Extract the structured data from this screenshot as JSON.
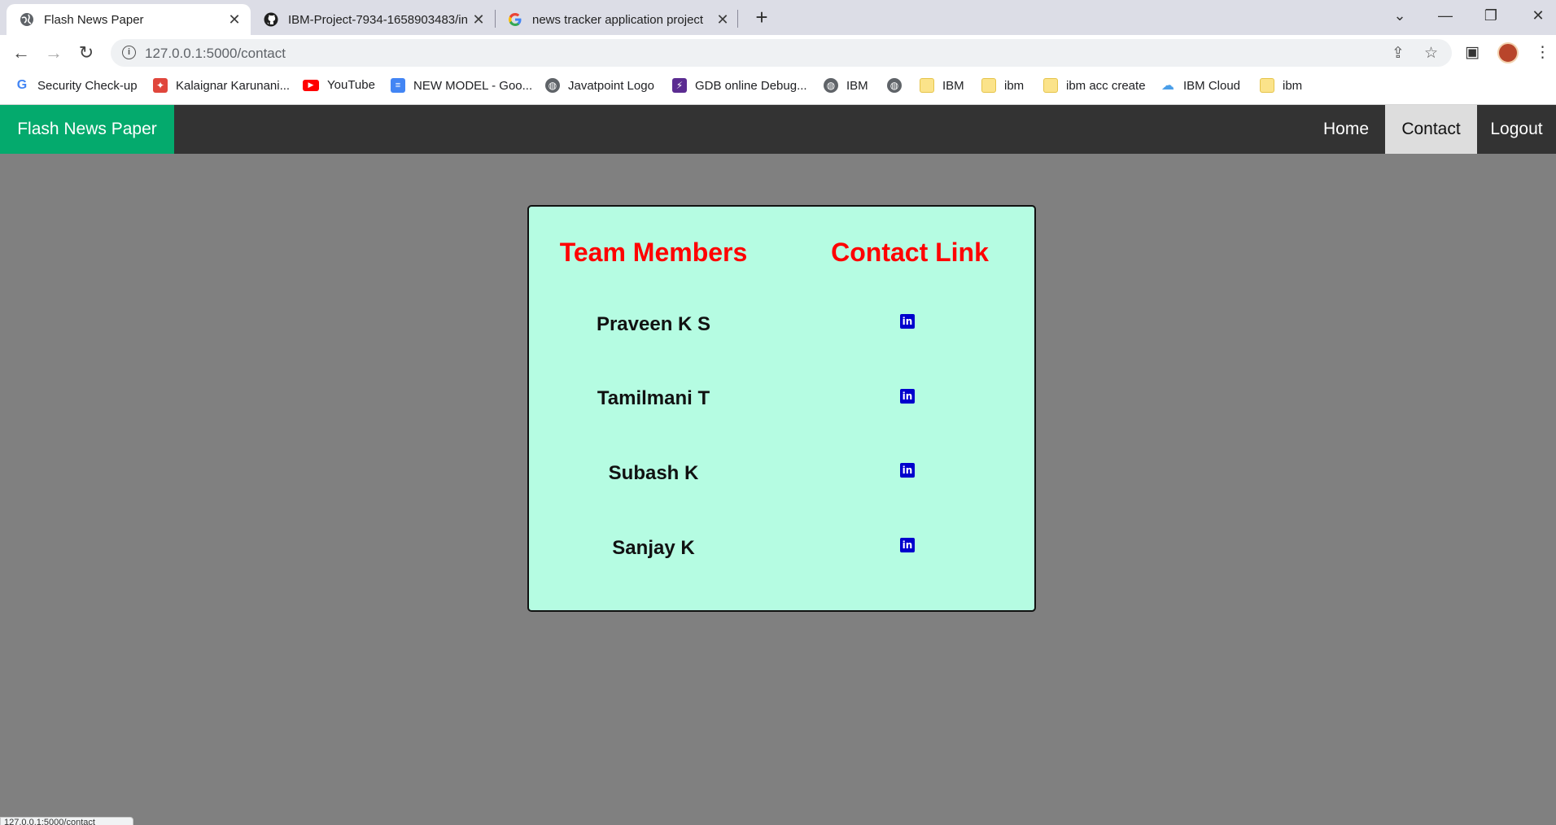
{
  "browser": {
    "tabs": [
      {
        "title": "Flash News Paper",
        "icon": "globe-icon",
        "active": true
      },
      {
        "title": "IBM-Project-7934-1658903483/in",
        "icon": "github-icon",
        "active": false
      },
      {
        "title": "news tracker application project",
        "icon": "google-icon",
        "active": false
      }
    ],
    "new_tab": "+",
    "url": "127.0.0.1:5000/contact",
    "bookmarks": [
      {
        "label": "Security Check-up",
        "icon": "google-icon"
      },
      {
        "label": "Kalaignar Karunani...",
        "icon": "site-icon"
      },
      {
        "label": "YouTube",
        "icon": "youtube-icon"
      },
      {
        "label": "NEW MODEL - Goo...",
        "icon": "docs-icon"
      },
      {
        "label": "Javatpoint Logo",
        "icon": "globe-icon"
      },
      {
        "label": "GDB online Debug...",
        "icon": "gdb-icon"
      },
      {
        "label": "IBM",
        "icon": "globe-icon"
      },
      {
        "label": "",
        "icon": "globe-icon"
      },
      {
        "label": "IBM",
        "icon": "folder-icon"
      },
      {
        "label": "ibm",
        "icon": "folder-icon"
      },
      {
        "label": "ibm acc create",
        "icon": "folder-icon"
      },
      {
        "label": "IBM Cloud",
        "icon": "cloud-icon"
      },
      {
        "label": "ibm",
        "icon": "folder-icon"
      }
    ],
    "status_text": "127.0.0.1:5000/contact"
  },
  "page": {
    "brand": "Flash News Paper",
    "nav": {
      "home": "Home",
      "contact": "Contact",
      "logout": "Logout"
    },
    "table": {
      "headers": [
        "Team Members",
        "Contact Link"
      ],
      "members": [
        {
          "name": "Praveen K S",
          "link_icon": "linkedin-icon"
        },
        {
          "name": "Tamilmani T",
          "link_icon": "linkedin-icon"
        },
        {
          "name": "Subash K",
          "link_icon": "linkedin-icon"
        },
        {
          "name": "Sanjay K",
          "link_icon": "linkedin-icon"
        }
      ]
    },
    "colors": {
      "brand_green": "#04aa6d",
      "navbar": "#333333",
      "card_bg": "#b5fce2",
      "header_red": "#ff0000",
      "linkedin_blue": "#0000cd",
      "page_bg": "#808080"
    }
  }
}
